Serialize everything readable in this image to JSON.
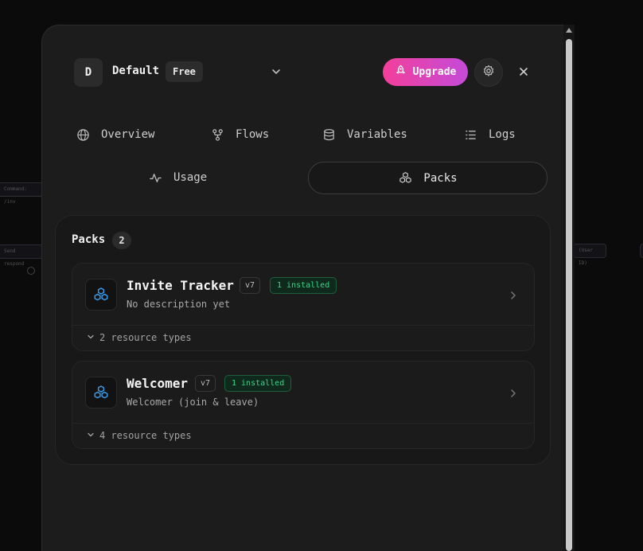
{
  "background": {
    "node_command": "Command: /inv",
    "node_send": "Send respond",
    "node_user": "(User ID)"
  },
  "header": {
    "avatar_letter": "D",
    "workspace_name": "Default",
    "plan": "Free",
    "upgrade_label": "Upgrade"
  },
  "nav": {
    "overview": "Overview",
    "flows": "Flows",
    "variables": "Variables",
    "logs": "Logs",
    "usage": "Usage",
    "packs": "Packs"
  },
  "packs": {
    "title": "Packs",
    "count": "2",
    "items": [
      {
        "name": "Invite Tracker",
        "version": "v7",
        "installed": "1 installed",
        "description": "No description yet",
        "resources": "2 resource types"
      },
      {
        "name": "Welcomer",
        "version": "v7",
        "installed": "1 installed",
        "description": "Welcomer (join & leave)",
        "resources": "4 resource types"
      }
    ]
  },
  "colors": {
    "accent_gradient_start": "#f33f9a",
    "accent_gradient_end": "#c44bd9",
    "installed_green": "#3fd48a",
    "pack_icon_blue": "#3b9be8"
  },
  "icons": {
    "workspace_dropdown": "chevron-down-icon",
    "upgrade": "rocket-icon",
    "settings": "gear-icon",
    "close": "close-icon",
    "overview": "globe-icon",
    "flows": "git-fork-icon",
    "variables": "database-icon",
    "logs": "list-icon",
    "usage": "activity-icon",
    "packs": "boxes-icon"
  }
}
